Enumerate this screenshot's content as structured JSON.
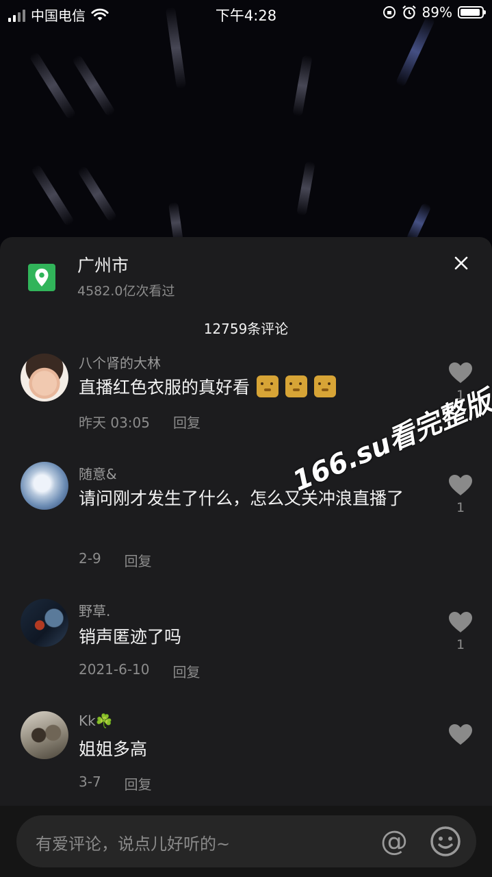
{
  "status_bar": {
    "carrier": "中国电信",
    "time": "下午4:28",
    "battery": "89%",
    "battery_level": 0.89
  },
  "sheet": {
    "location_name": "广州市",
    "location_views": "4582.0亿次看过",
    "comment_count": "12759条评论",
    "close_icon": "close-icon",
    "location_icon": "location-pin-icon"
  },
  "comments": [
    {
      "user": "八个肾的大林",
      "text": "直播红色衣服的真好看",
      "time": "昨天 03:05",
      "reply": "回复",
      "likes": "1",
      "emoji_count": 3
    },
    {
      "user": "随意&",
      "text": "请问刚才发生了什么，怎么又关冲浪直播了",
      "time": "2-9",
      "reply": "回复",
      "likes": "1"
    },
    {
      "user": "野草.",
      "text": "销声匿迹了吗",
      "time": "2021-6-10",
      "reply": "回复",
      "likes": "1"
    },
    {
      "user": "Kk☘️",
      "text": "姐姐多高",
      "time": "3-7",
      "reply": "回复",
      "likes": ""
    }
  ],
  "watermark": "166.su看完整版",
  "input": {
    "placeholder": "有爱评论，说点儿好听的~",
    "at_symbol": "@"
  },
  "colors": {
    "sheet_bg": "#1c1c1e",
    "location_green": "#31b45a"
  }
}
